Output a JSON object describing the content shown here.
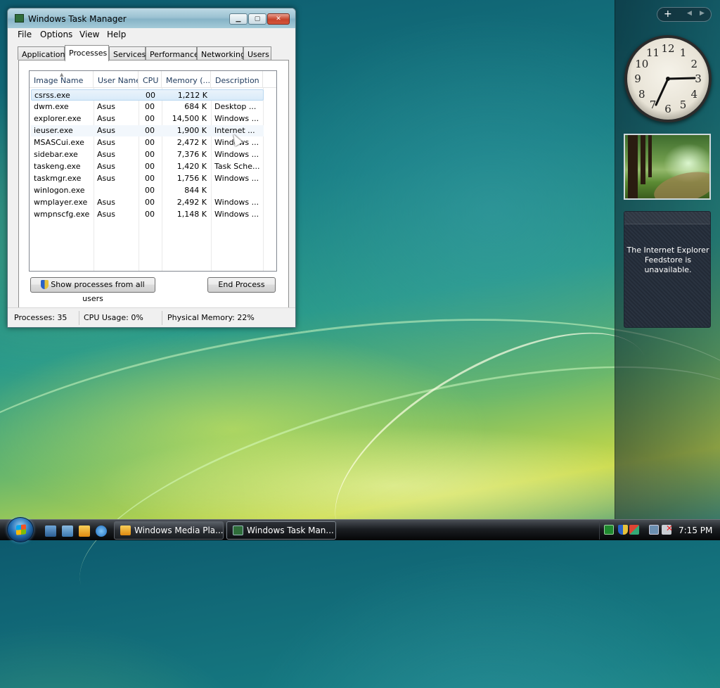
{
  "window": {
    "title": "Windows Task Manager",
    "menu": [
      "File",
      "Options",
      "View",
      "Help"
    ],
    "tabs": [
      "Applications",
      "Processes",
      "Services",
      "Performance",
      "Networking",
      "Users"
    ],
    "active_tab": "Processes",
    "columns": [
      "Image Name",
      "User Name",
      "CPU",
      "Memory (...",
      "Description"
    ],
    "rows": [
      {
        "name": "csrss.exe",
        "user": "",
        "cpu": "00",
        "mem": "1,212 K",
        "desc": ""
      },
      {
        "name": "dwm.exe",
        "user": "Asus",
        "cpu": "00",
        "mem": "684 K",
        "desc": "Desktop ..."
      },
      {
        "name": "explorer.exe",
        "user": "Asus",
        "cpu": "00",
        "mem": "14,500 K",
        "desc": "Windows ..."
      },
      {
        "name": "ieuser.exe",
        "user": "Asus",
        "cpu": "00",
        "mem": "1,900 K",
        "desc": "Internet ..."
      },
      {
        "name": "MSASCui.exe",
        "user": "Asus",
        "cpu": "00",
        "mem": "2,472 K",
        "desc": "Windows ..."
      },
      {
        "name": "sidebar.exe",
        "user": "Asus",
        "cpu": "00",
        "mem": "7,376 K",
        "desc": "Windows ..."
      },
      {
        "name": "taskeng.exe",
        "user": "Asus",
        "cpu": "00",
        "mem": "1,420 K",
        "desc": "Task Sche..."
      },
      {
        "name": "taskmgr.exe",
        "user": "Asus",
        "cpu": "00",
        "mem": "1,756 K",
        "desc": "Windows ..."
      },
      {
        "name": "winlogon.exe",
        "user": "",
        "cpu": "00",
        "mem": "844 K",
        "desc": ""
      },
      {
        "name": "wmplayer.exe",
        "user": "Asus",
        "cpu": "00",
        "mem": "2,492 K",
        "desc": "Windows ..."
      },
      {
        "name": "wmpnscfg.exe",
        "user": "Asus",
        "cpu": "00",
        "mem": "1,148 K",
        "desc": "Windows ..."
      }
    ],
    "show_all_label": "Show processes from all users",
    "end_process_label": "End Process",
    "status": {
      "processes": "Processes: 35",
      "cpu": "CPU Usage: 0%",
      "memory": "Physical Memory: 22%"
    }
  },
  "sidebar": {
    "add_label": "+",
    "clock_numbers": [
      "12",
      "1",
      "2",
      "3",
      "4",
      "5",
      "6",
      "7",
      "8",
      "9",
      "10",
      "11"
    ],
    "feed_message": "The Internet Explorer Feedstore is unavailable."
  },
  "taskbar": {
    "tasks": [
      "Windows Media Pla...",
      "Windows Task Man..."
    ],
    "active_task": "Windows Task Man...",
    "time": "7:15 PM"
  },
  "colors": {
    "accent": "#2a74b8",
    "selection": "#d9ebf9",
    "close_button": "#c7432b"
  }
}
